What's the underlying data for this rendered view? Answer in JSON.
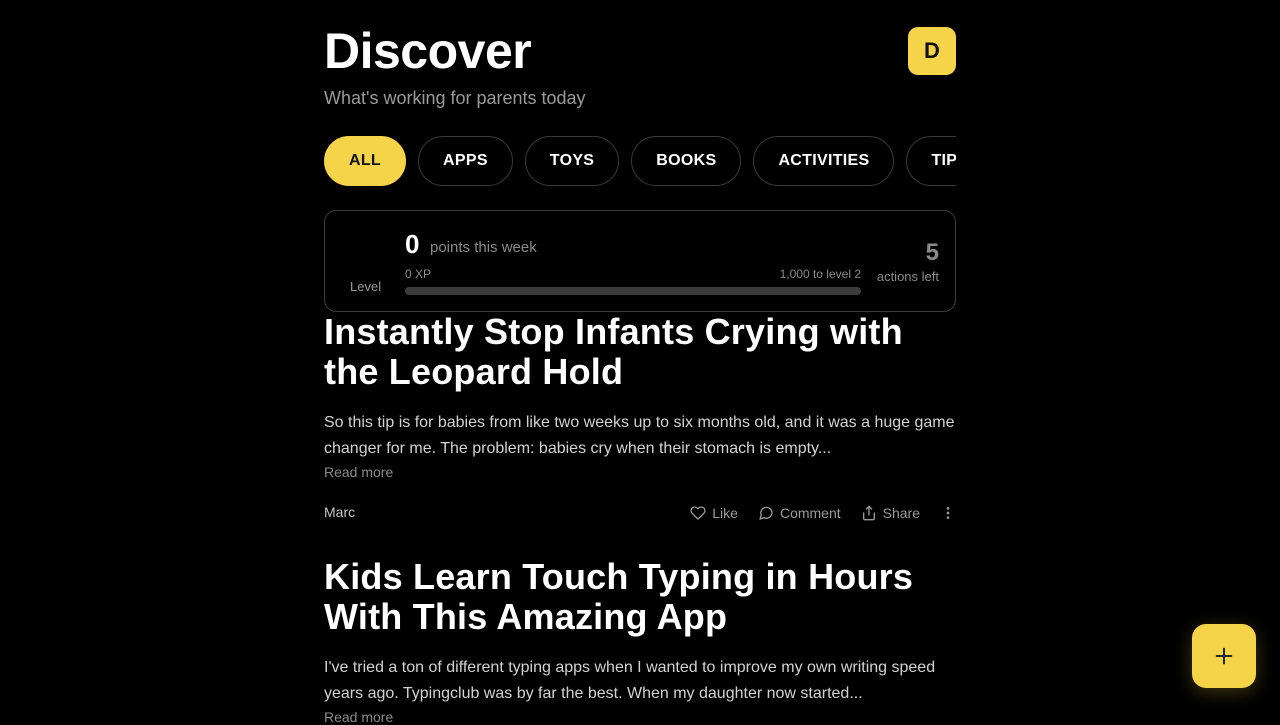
{
  "header": {
    "title": "Discover",
    "subtitle": "What's working for parents today",
    "avatar_letter": "D"
  },
  "filters": [
    {
      "label": "ALL",
      "active": true
    },
    {
      "label": "APPS",
      "active": false
    },
    {
      "label": "TOYS",
      "active": false
    },
    {
      "label": "BOOKS",
      "active": false
    },
    {
      "label": "ACTIVITIES",
      "active": false
    },
    {
      "label": "TIPS",
      "active": false
    }
  ],
  "xp": {
    "level_label": "Level",
    "points": "0",
    "points_label": "points this week",
    "xp_value": "0 XP",
    "next_level": "1,000 to level 2",
    "progress_fraction": 0,
    "actions_left": "5",
    "actions_label": "actions left"
  },
  "posts": [
    {
      "title": "Instantly Stop Infants Crying with the Leopard Hold",
      "body": "So this tip is for babies from like two weeks up to six months old, and it was a huge game changer for me. The problem: babies cry when their stomach is empty...",
      "read_more": "Read more",
      "author": "Marc",
      "like": "Like",
      "comment": "Comment",
      "share": "Share"
    },
    {
      "title": "Kids Learn Touch Typing in Hours With This Amazing App",
      "body": "I've tried a ton of different typing apps when I wanted to improve my own writing speed years ago. Typingclub was by far the best. When my daughter now started...",
      "read_more": "Read more"
    }
  ],
  "colors": {
    "accent": "#f5d44a",
    "background": "#000000",
    "muted": "#8a8a8a"
  },
  "icons": {
    "like": "heart-icon",
    "comment": "comment-icon",
    "share": "share-icon",
    "more": "more-vertical-icon",
    "fab": "plus-icon"
  }
}
